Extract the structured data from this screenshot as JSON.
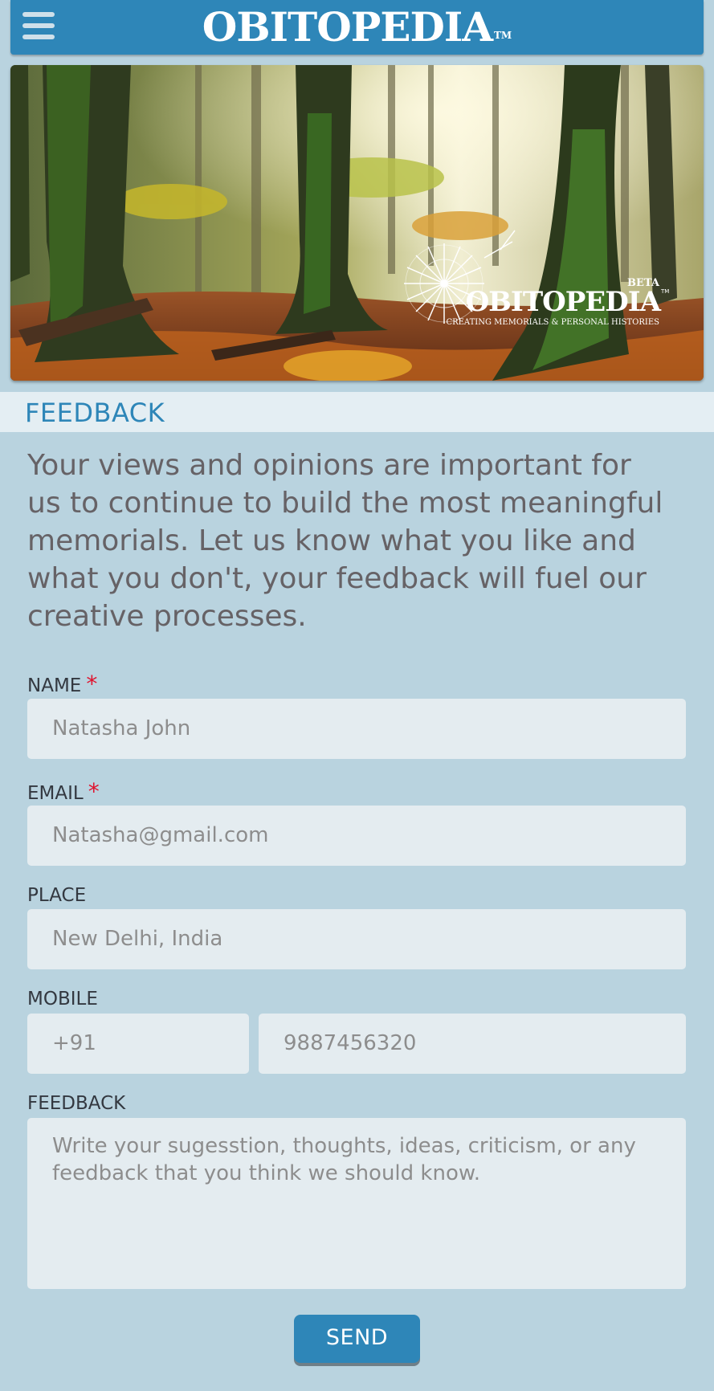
{
  "header": {
    "brand": "OBITOPEDIA",
    "trademark": "TM",
    "menu_icon": "hamburger-menu-icon"
  },
  "hero": {
    "logo_badge": "BETA",
    "logo_text": "OBITOPEDIA",
    "logo_trademark": "TM",
    "tagline": "CREATING MEMORIALS & PERSONAL HISTORIES",
    "logo_icon": "dandelion-icon"
  },
  "section": {
    "title": "FEEDBACK"
  },
  "intro": "Your views and opinions are important for us to continue to build the most meaningful memorials. Let us know what you like and what you don't, your feedback will fuel our creative processes.",
  "form": {
    "name": {
      "label": "NAME",
      "required_mark": "*",
      "value": "Natasha John"
    },
    "email": {
      "label": "EMAIL",
      "required_mark": "*",
      "value": "Natasha@gmail.com"
    },
    "place": {
      "label": "PLACE",
      "value": "New Delhi, India"
    },
    "mobile": {
      "label": "MOBILE",
      "code": "+91",
      "number": "9887456320"
    },
    "feedback": {
      "label": "FEEDBACK",
      "placeholder": "Write your sugesstion, thoughts, ideas, criticism, or any feedback that you think we should know."
    },
    "send_label": "SEND"
  },
  "colors": {
    "primary": "#2e86b8",
    "background": "#b9d3df",
    "field": "#e4ecf0",
    "required": "#e0132e"
  }
}
